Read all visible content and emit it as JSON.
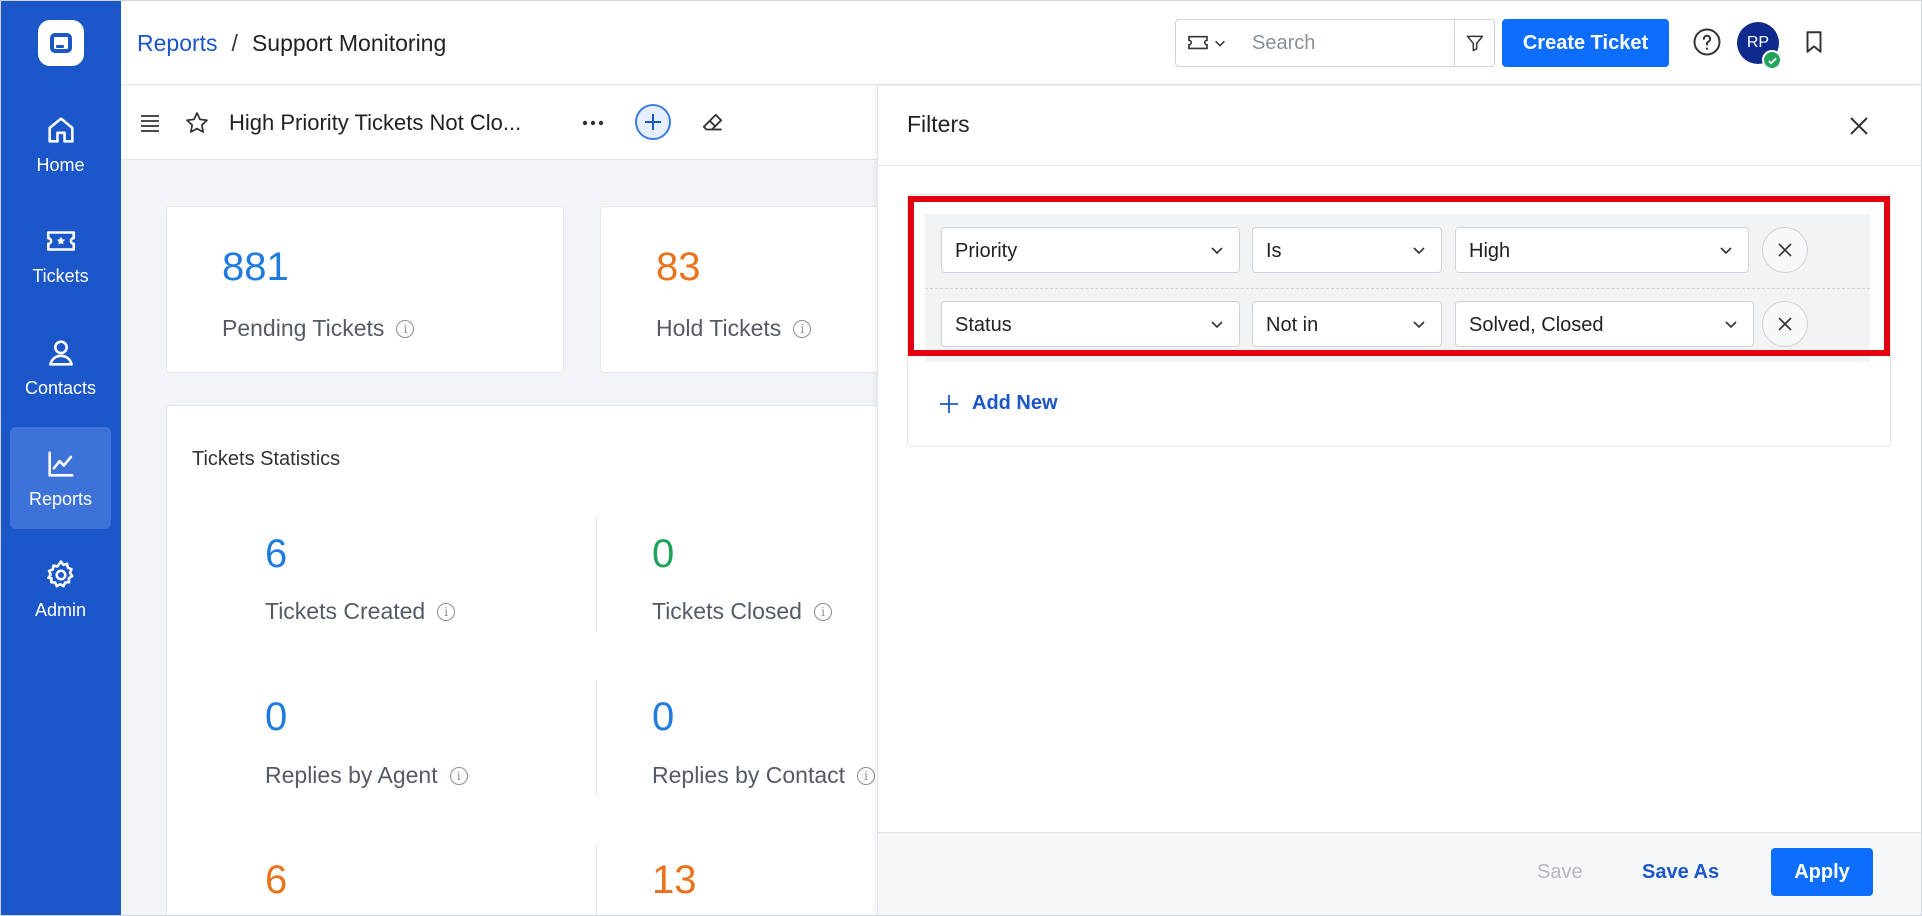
{
  "sidebar": {
    "items": [
      {
        "label": "Home",
        "icon": "home-icon"
      },
      {
        "label": "Tickets",
        "icon": "ticket-icon"
      },
      {
        "label": "Contacts",
        "icon": "user-icon"
      },
      {
        "label": "Reports",
        "icon": "chart-icon",
        "active": true
      },
      {
        "label": "Admin",
        "icon": "gear-icon"
      }
    ]
  },
  "header": {
    "breadcrumb_root": "Reports",
    "breadcrumb_sep": "/",
    "breadcrumb_current": "Support Monitoring",
    "search_placeholder": "Search",
    "create_label": "Create Ticket",
    "avatar_initials": "RP"
  },
  "toolbar": {
    "report_title": "High Priority Tickets Not Clo..."
  },
  "summary_cards": [
    {
      "value": "881",
      "label": "Pending Tickets"
    },
    {
      "value": "83",
      "label": "Hold Tickets"
    }
  ],
  "statistics": {
    "title": "Tickets Statistics",
    "items": [
      {
        "value": "6",
        "label": "Tickets Created"
      },
      {
        "value": "0",
        "label": "Tickets Closed"
      },
      {
        "value": "0",
        "label": "Replies by Agent"
      },
      {
        "value": "0",
        "label": "Replies by Contact"
      },
      {
        "value": "6",
        "label": ""
      },
      {
        "value": "13",
        "label": ""
      }
    ]
  },
  "filters": {
    "title": "Filters",
    "rows": [
      {
        "field": "Priority",
        "operator": "Is",
        "value": "High"
      },
      {
        "field": "Status",
        "operator": "Not in",
        "value": "Solved, Closed"
      }
    ],
    "add_new_label": "Add New",
    "save_label": "Save",
    "save_as_label": "Save As",
    "apply_label": "Apply"
  },
  "colors": {
    "sidebar": "#1b57c9",
    "primary": "#0d6efd",
    "highlight": "#e3000e",
    "value_blue": "#1e7be0",
    "value_orange": "#e8731c",
    "value_green": "#1ea35a"
  }
}
